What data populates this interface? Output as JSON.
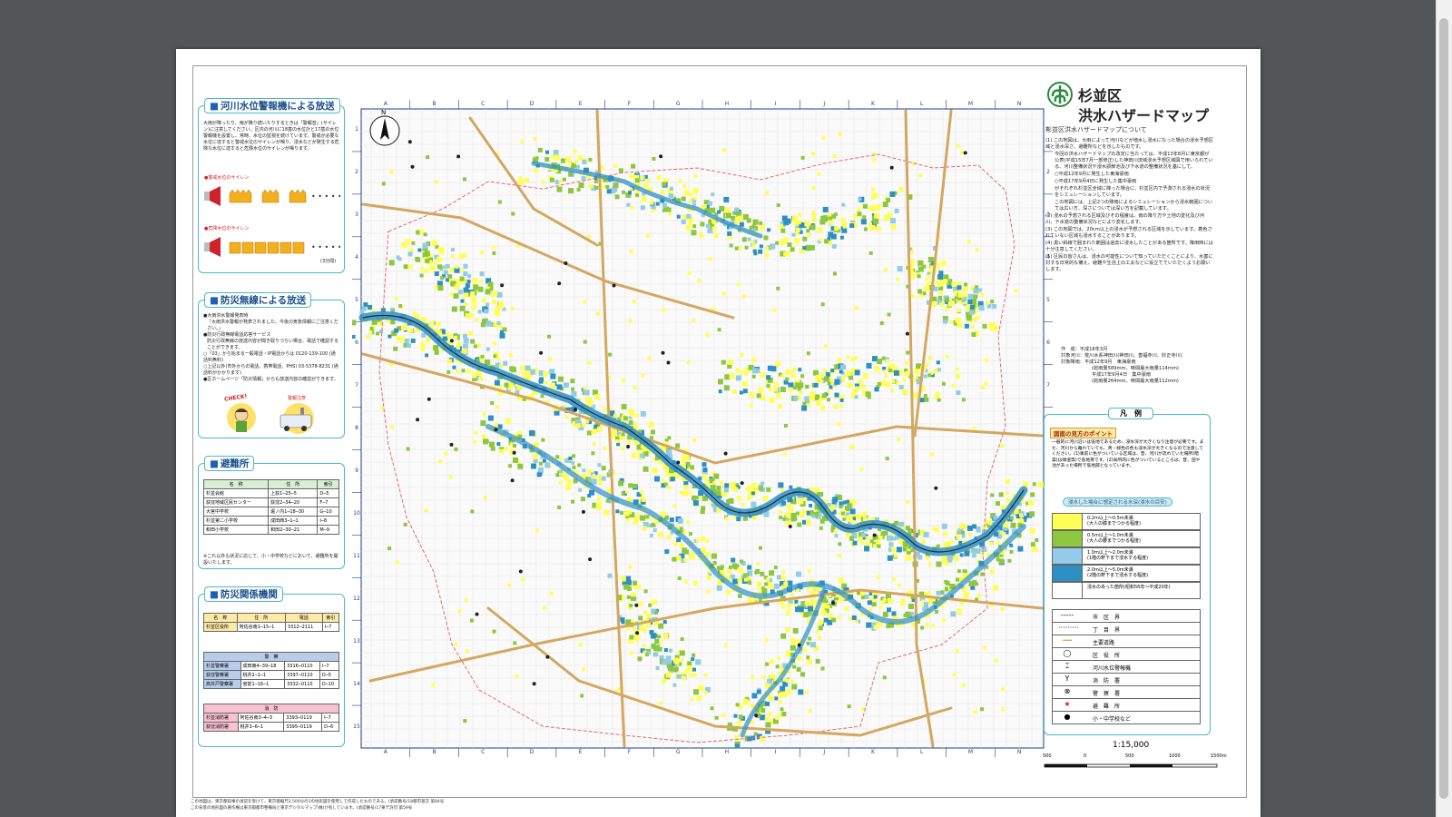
{
  "document": {
    "title_line1": "杉並区",
    "title_line2": "洪水ハザードマップ",
    "about_heading": "杉並区洪水ハザードマップについて",
    "about_points": [
      "(1) この地図は、大雨によって河川などが増水し浸水になった場合の浸水予想区域と浸水深さ、避難所などを示したものです。",
      "今回の洪水ハザードマップの改定に当たっては、平成13年8月に東京都が公表(平成15年7月一部修正)した神田川流域浸水予想区域図で用いられている、河川整備状況や浸水調節池及び下水道の整備状況を基にして、",
      "○平成12年9月に発生した東海豪雨",
      "○平成17年9月4日に発生した集中豪雨",
      "がそれぞれ杉並区全域に降った場合に、杉並区内で予測される浸水の状況をシミュレーションしています。",
      "この地図には、上記2つの降雨によるシミュレーションから浸水範囲については広い方、深さについては深い方を記載しています。",
      "(2) 浸水の予想される区域及びその程度は、雨の降り方や土地の変化及び河川、下水道の整備状況などにより変化します。",
      "(3) この地図では、20cm以上の浸水が予想される区域を示しています。着色されていない区域も浸水することがあります。",
      "(4) 黒い斜線で囲まれた範囲は過去に浸水したことがある箇所です。降雨時には十分注意してください。",
      "(5) 区民の皆さんは、浸水の可能性について知っていただくことにより、水害に対する日常的な備え、避難や生活上の工夫などに役立てていただくようお願いします。"
    ],
    "meta": [
      "作　成：平成18年3月",
      "対象河川：荒川水系神田川(神田川、善福寺川、妙正寺川)",
      "対象降雨：平成12年9月　東海豪雨",
      "(総雨量589mm、時間最大雨量114mm)",
      "平成17年9月4日　集中豪雨",
      "(総雨量264mm、時間最大雨量112mm)"
    ],
    "footer_notes": [
      "この地図は、東京都知事の承認を受けて、東京都縮尺2,500分の1の地形図を使用して作成したものである。(承認番号)18都市基交 第84号",
      "この背景の地形図の著作権は東京都都市整備局と東京デジタルマップ(株)が有しています。(承認番号)17東デ許可 第59号"
    ],
    "scale_text": "1:15,000",
    "scale_ticks": [
      "500",
      "0",
      "500",
      "1000",
      "1500m"
    ]
  },
  "left_panels": {
    "river_alarm": {
      "title": "河川水位警報機による放送",
      "text": "大雨が降ったり、雨が降り続いたりするときは「警報音」(サイレン)に注意してください。区内の河川に18基の水位計と17基の水位警報機を設置し、常時、水位の監視を続けています。警戒が必要な水位に達すると警戒水位のサイレンが鳴り、浸水などが発生する危険な水位に達すると危険水位のサイレンが鳴ります。",
      "siren1_label": "●警戒水位のサイレン",
      "siren2_label": "●危険水位のサイレン",
      "siren_note": "(3分間)"
    },
    "radio": {
      "title": "防災無線による放送",
      "items": [
        "●大雨洪水警報発表時",
        "「大雨洪水警報が発表されました。今後の気象情報にご注意ください。」",
        "●防災行政無線電話応答サービス",
        "防災行政無線の放送内容が聞き取りづらい場合、電話で確認することができます。",
        "○「03」から始まる一般電話・IP電話からは 0120-139-100 (通話料無料)",
        "○上記以外(市外からの電話、携帯電話、PHS) 03-5378-8231 (通話料がかかります)",
        "●区ホームページ「防災情報」からも放送内容の確認ができます。"
      ],
      "check_label": "CHECK!",
      "alert_label": "警報注意"
    },
    "shelters": {
      "title": "避難所",
      "headers": [
        "名　称",
        "住　所",
        "索引"
      ],
      "rows": [
        [
          "杉並会館",
          "上荻1─25─5",
          "D─5"
        ],
        [
          "荻窪地域区民センター",
          "荻窪2─34─20",
          "F─7"
        ],
        [
          "大宮中学校",
          "堀ノ内1─18─30",
          "G─10"
        ],
        [
          "杉並第二小学校",
          "成田西3─1─1",
          "I─8"
        ],
        [
          "和田小学校",
          "和田2─30─21",
          "M─9"
        ]
      ],
      "note": "※これ以外も状況に応じて、小・中学校などにおいて、避難所を開設いたします。"
    },
    "agencies": {
      "title": "防災関係機関",
      "headers": [
        "名　称",
        "住　所",
        "電話",
        "索引"
      ],
      "ward_rows": [
        [
          "杉並区役所",
          "阿佐谷南1─15─1",
          "3312─2111",
          "I─7"
        ]
      ],
      "police_label": "警　察",
      "police_rows": [
        [
          "杉並警察署",
          "成田東4─39─18",
          "3316─0110",
          "I─7"
        ],
        [
          "荻窪警察署",
          "桃井2─1─1",
          "3397─0110",
          "D─5"
        ],
        [
          "高井戸警察署",
          "宮前1─16─1",
          "3332─0110",
          "D─10"
        ]
      ],
      "fire_label": "消　防",
      "fire_rows": [
        [
          "杉並消防署",
          "阿佐谷南3─4─3",
          "3393─0119",
          "I─7"
        ],
        [
          "荻窪消防署",
          "桃井3─6─1",
          "3395─0119",
          "D─6"
        ]
      ]
    }
  },
  "map": {
    "col_labels": [
      "A",
      "B",
      "C",
      "D",
      "E",
      "F",
      "G",
      "H",
      "I",
      "J",
      "K",
      "L",
      "M",
      "N"
    ],
    "row_labels": [
      "1",
      "2",
      "3",
      "4",
      "5",
      "6",
      "7",
      "8",
      "9",
      "10",
      "11",
      "12",
      "13",
      "14",
      "15"
    ],
    "north_label": "N",
    "colors": {
      "shallow": "#ffff55",
      "knee": "#8dc63f",
      "floor": "#93cbe9",
      "deep": "#2e8fc4",
      "road": "#d4a760",
      "boundary": "#e26a7a"
    }
  },
  "legend": {
    "title": "凡　例",
    "point_title": "図面の見方のポイント",
    "point_text": "一般的に河川沿いは低地であるため、浸水深が大きくなり注意が必要です。また、河川から離れていても、青・緑色の色も浸水深が大きくなるので注意してください。(1)事前に色がついている区域は、昔、河川が流れていた場所(暗渠)は緑道等)で低地帯です。(2)局所的に色がついているところは、昔、田や池があった場所で低地部となっています。",
    "depth_title": "浸水した場合に想定される水深(浸水の目安)",
    "depth_items": [
      {
        "range": "0.2m以上～0.5m未満",
        "desc": "(大人の膝までつかる程度)"
      },
      {
        "range": "0.5m以上～1.0m未満",
        "desc": "(大人の腰までつかる程度)"
      },
      {
        "range": "1.0m以上～2.0m未満",
        "desc": "(1階の軒下まで浸水する程度)"
      },
      {
        "range": "2.0m以上～5.0m未満",
        "desc": "(2階の軒下まで浸水する程度)"
      },
      {
        "range": "浸水のあった箇所(昭和56年～平成20年)",
        "desc": ""
      }
    ],
    "symbols": [
      {
        "sym": "-----",
        "label": "市　区　界"
      },
      {
        "sym": "·········",
        "label": "丁　目　界"
      },
      {
        "sym": "━━",
        "label": "主要道路"
      },
      {
        "sym": "◯",
        "label": "区　役　所"
      },
      {
        "sym": "⌶",
        "label": "河川水位警報機"
      },
      {
        "sym": "Y",
        "label": "消　防　署"
      },
      {
        "sym": "⊗",
        "label": "警　察　署"
      },
      {
        "sym": "★",
        "label": "避　難　所"
      },
      {
        "sym": "●",
        "label": "小・中学校など"
      }
    ]
  }
}
